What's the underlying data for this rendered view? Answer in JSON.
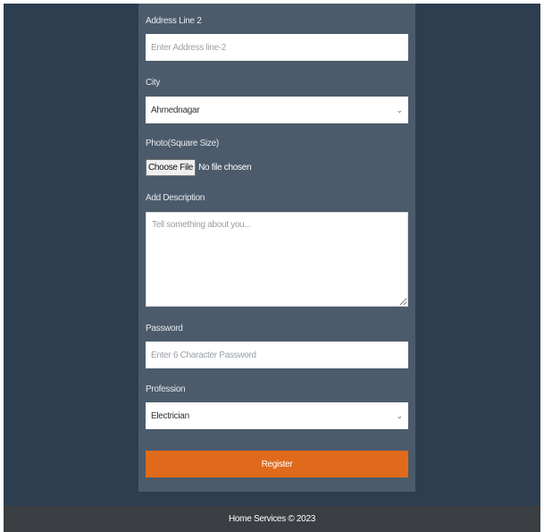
{
  "form": {
    "address2": {
      "label": "Address Line 2",
      "placeholder": "Enter Address line-2",
      "value": ""
    },
    "city": {
      "label": "City",
      "value": "Ahmednagar"
    },
    "photo": {
      "label": "Photo(Square Size)",
      "button": "Choose File",
      "status": "No file chosen"
    },
    "description": {
      "label": "Add Description",
      "placeholder": "Tell something about you..."
    },
    "password": {
      "label": "Password",
      "placeholder": "Enter 6 Character Password"
    },
    "profession": {
      "label": "Profession",
      "value": "Electrician"
    },
    "submit_label": "Register"
  },
  "footer": {
    "text": "Home Services © 2023"
  },
  "colors": {
    "page_background": "#2d3e50",
    "form_panel": "#4b5b6b",
    "register_button": "#e06a1b",
    "footer": "#3b3f44"
  },
  "icons": {
    "select_arrow": "chevron-down-icon"
  }
}
